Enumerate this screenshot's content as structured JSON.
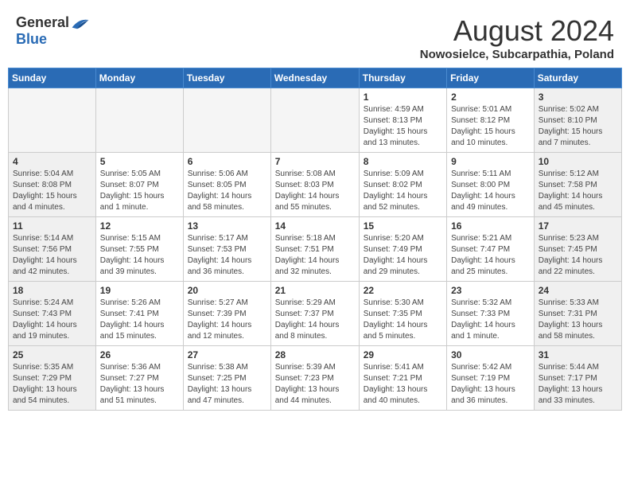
{
  "header": {
    "logo_general": "General",
    "logo_blue": "Blue",
    "month_year": "August 2024",
    "location": "Nowosielce, Subcarpathia, Poland"
  },
  "days_of_week": [
    "Sunday",
    "Monday",
    "Tuesday",
    "Wednesday",
    "Thursday",
    "Friday",
    "Saturday"
  ],
  "weeks": [
    [
      {
        "day": "",
        "info": ""
      },
      {
        "day": "",
        "info": ""
      },
      {
        "day": "",
        "info": ""
      },
      {
        "day": "",
        "info": ""
      },
      {
        "day": "1",
        "info": "Sunrise: 4:59 AM\nSunset: 8:13 PM\nDaylight: 15 hours and 13 minutes."
      },
      {
        "day": "2",
        "info": "Sunrise: 5:01 AM\nSunset: 8:12 PM\nDaylight: 15 hours and 10 minutes."
      },
      {
        "day": "3",
        "info": "Sunrise: 5:02 AM\nSunset: 8:10 PM\nDaylight: 15 hours and 7 minutes."
      }
    ],
    [
      {
        "day": "4",
        "info": "Sunrise: 5:04 AM\nSunset: 8:08 PM\nDaylight: 15 hours and 4 minutes."
      },
      {
        "day": "5",
        "info": "Sunrise: 5:05 AM\nSunset: 8:07 PM\nDaylight: 15 hours and 1 minute."
      },
      {
        "day": "6",
        "info": "Sunrise: 5:06 AM\nSunset: 8:05 PM\nDaylight: 14 hours and 58 minutes."
      },
      {
        "day": "7",
        "info": "Sunrise: 5:08 AM\nSunset: 8:03 PM\nDaylight: 14 hours and 55 minutes."
      },
      {
        "day": "8",
        "info": "Sunrise: 5:09 AM\nSunset: 8:02 PM\nDaylight: 14 hours and 52 minutes."
      },
      {
        "day": "9",
        "info": "Sunrise: 5:11 AM\nSunset: 8:00 PM\nDaylight: 14 hours and 49 minutes."
      },
      {
        "day": "10",
        "info": "Sunrise: 5:12 AM\nSunset: 7:58 PM\nDaylight: 14 hours and 45 minutes."
      }
    ],
    [
      {
        "day": "11",
        "info": "Sunrise: 5:14 AM\nSunset: 7:56 PM\nDaylight: 14 hours and 42 minutes."
      },
      {
        "day": "12",
        "info": "Sunrise: 5:15 AM\nSunset: 7:55 PM\nDaylight: 14 hours and 39 minutes."
      },
      {
        "day": "13",
        "info": "Sunrise: 5:17 AM\nSunset: 7:53 PM\nDaylight: 14 hours and 36 minutes."
      },
      {
        "day": "14",
        "info": "Sunrise: 5:18 AM\nSunset: 7:51 PM\nDaylight: 14 hours and 32 minutes."
      },
      {
        "day": "15",
        "info": "Sunrise: 5:20 AM\nSunset: 7:49 PM\nDaylight: 14 hours and 29 minutes."
      },
      {
        "day": "16",
        "info": "Sunrise: 5:21 AM\nSunset: 7:47 PM\nDaylight: 14 hours and 25 minutes."
      },
      {
        "day": "17",
        "info": "Sunrise: 5:23 AM\nSunset: 7:45 PM\nDaylight: 14 hours and 22 minutes."
      }
    ],
    [
      {
        "day": "18",
        "info": "Sunrise: 5:24 AM\nSunset: 7:43 PM\nDaylight: 14 hours and 19 minutes."
      },
      {
        "day": "19",
        "info": "Sunrise: 5:26 AM\nSunset: 7:41 PM\nDaylight: 14 hours and 15 minutes."
      },
      {
        "day": "20",
        "info": "Sunrise: 5:27 AM\nSunset: 7:39 PM\nDaylight: 14 hours and 12 minutes."
      },
      {
        "day": "21",
        "info": "Sunrise: 5:29 AM\nSunset: 7:37 PM\nDaylight: 14 hours and 8 minutes."
      },
      {
        "day": "22",
        "info": "Sunrise: 5:30 AM\nSunset: 7:35 PM\nDaylight: 14 hours and 5 minutes."
      },
      {
        "day": "23",
        "info": "Sunrise: 5:32 AM\nSunset: 7:33 PM\nDaylight: 14 hours and 1 minute."
      },
      {
        "day": "24",
        "info": "Sunrise: 5:33 AM\nSunset: 7:31 PM\nDaylight: 13 hours and 58 minutes."
      }
    ],
    [
      {
        "day": "25",
        "info": "Sunrise: 5:35 AM\nSunset: 7:29 PM\nDaylight: 13 hours and 54 minutes."
      },
      {
        "day": "26",
        "info": "Sunrise: 5:36 AM\nSunset: 7:27 PM\nDaylight: 13 hours and 51 minutes."
      },
      {
        "day": "27",
        "info": "Sunrise: 5:38 AM\nSunset: 7:25 PM\nDaylight: 13 hours and 47 minutes."
      },
      {
        "day": "28",
        "info": "Sunrise: 5:39 AM\nSunset: 7:23 PM\nDaylight: 13 hours and 44 minutes."
      },
      {
        "day": "29",
        "info": "Sunrise: 5:41 AM\nSunset: 7:21 PM\nDaylight: 13 hours and 40 minutes."
      },
      {
        "day": "30",
        "info": "Sunrise: 5:42 AM\nSunset: 7:19 PM\nDaylight: 13 hours and 36 minutes."
      },
      {
        "day": "31",
        "info": "Sunrise: 5:44 AM\nSunset: 7:17 PM\nDaylight: 13 hours and 33 minutes."
      }
    ]
  ]
}
